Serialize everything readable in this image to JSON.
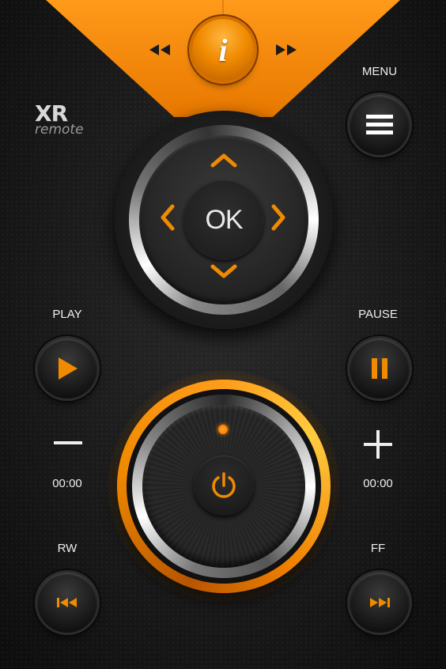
{
  "app": {
    "logo_main": "XR",
    "logo_sub": "remote"
  },
  "header": {
    "info_label": "i",
    "prev_icon": "rewind-icon",
    "next_icon": "fast-forward-icon"
  },
  "labels": {
    "menu": "MENU",
    "play": "PLAY",
    "pause": "PAUSE",
    "rw": "RW",
    "ff": "FF"
  },
  "dpad": {
    "ok": "OK"
  },
  "times": {
    "left": "00:00",
    "right": "00:00"
  },
  "colors": {
    "accent": "#f08a00",
    "background": "#1a1a1a"
  }
}
